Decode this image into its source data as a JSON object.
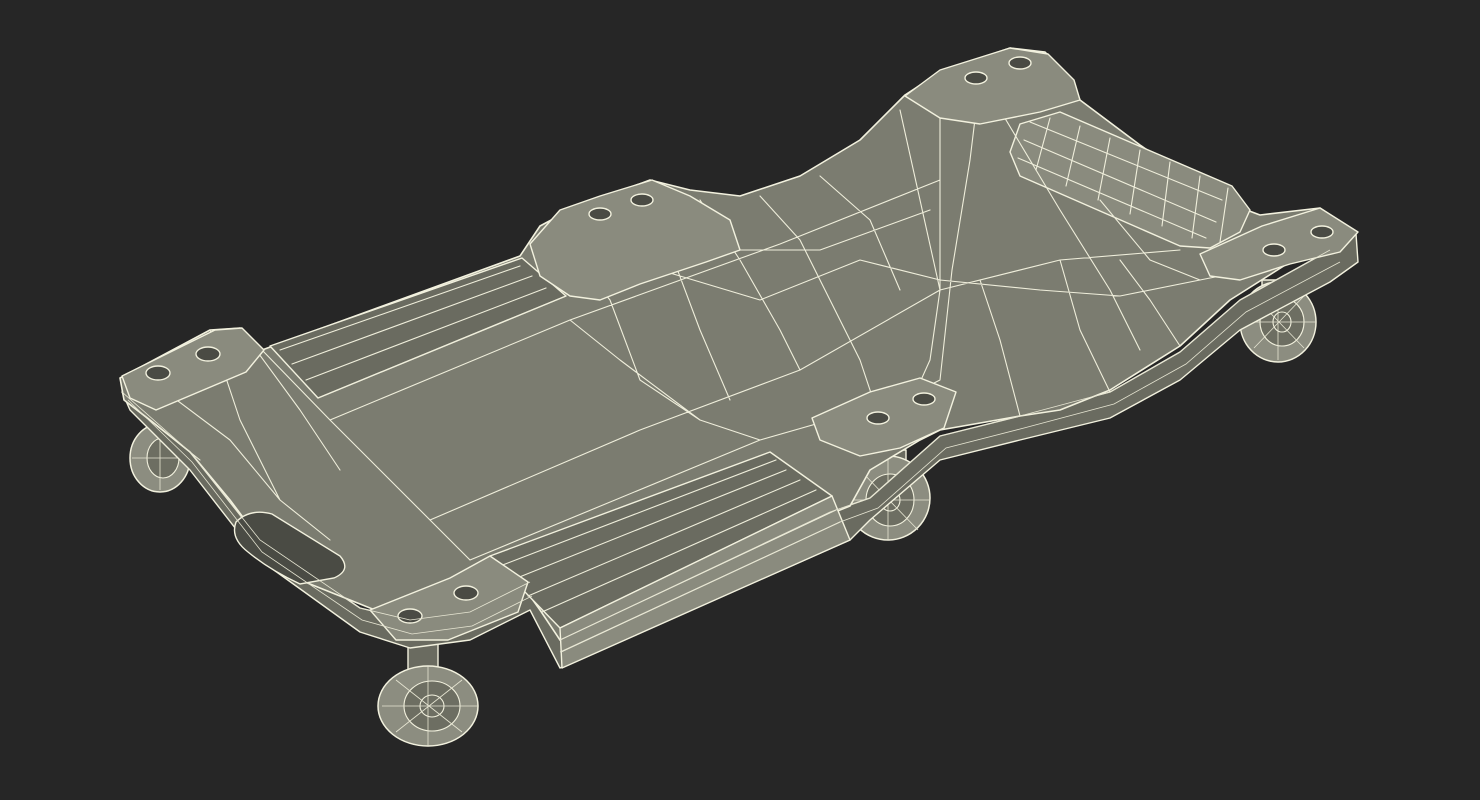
{
  "scene": {
    "subject_icon": "creeper-wireframe-icon",
    "background_color": "#262626",
    "body_color": "#7b7c70",
    "wire_color": "#f2f1de"
  }
}
